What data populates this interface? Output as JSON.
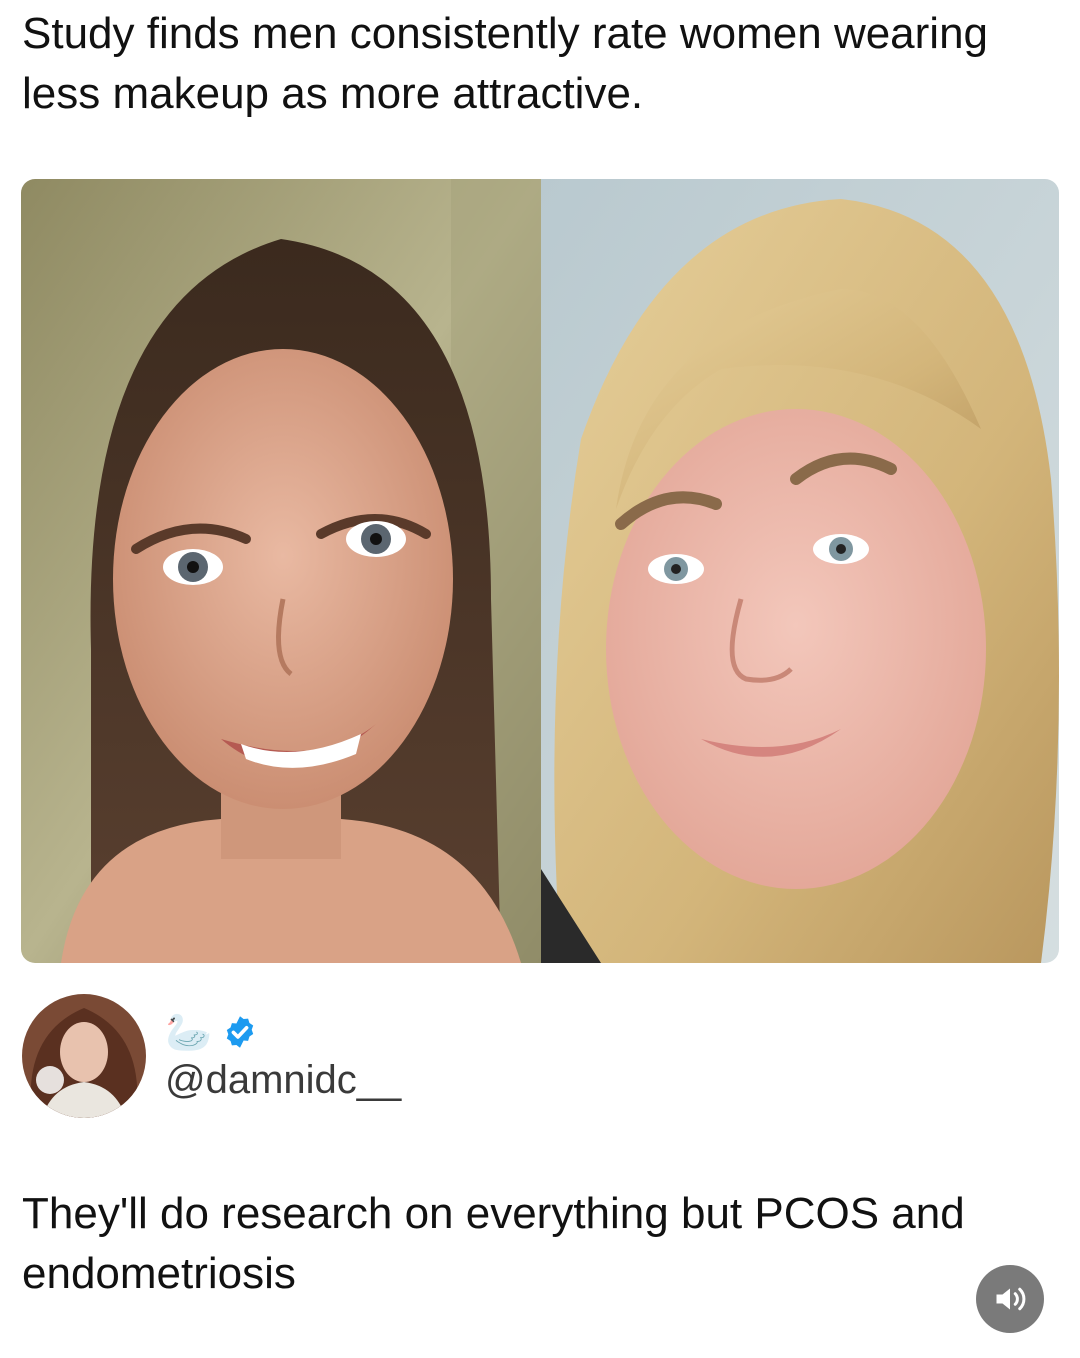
{
  "post": {
    "headline": "Study finds men consistently rate women wearing less makeup as more attractive.",
    "images": [
      {
        "label": "left-photo"
      },
      {
        "label": "right-photo"
      }
    ]
  },
  "author": {
    "name_emoji": "🦢",
    "verified": true,
    "handle": "@damnidc__"
  },
  "tweet": {
    "text": "They'll do research on everything but PCOS and endometriosis"
  },
  "controls": {
    "audio_icon": "speaker-icon"
  },
  "colors": {
    "verified_badge": "#1d9bf0",
    "audio_button_bg": "#7a7a7a"
  }
}
